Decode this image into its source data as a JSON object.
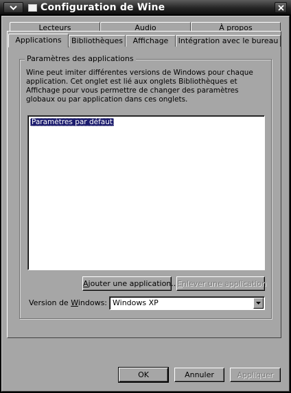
{
  "window": {
    "title": "Configuration de Wine",
    "icons": {
      "menu": "chevron-down-icon",
      "app": "window-icon",
      "close": "close-icon"
    }
  },
  "tabs": {
    "row_back": [
      "Lecteurs",
      "Audio",
      "À propos"
    ],
    "row_front": [
      "Applications",
      "Bibliothèques",
      "Affichage",
      "Intégration avec le bureau"
    ],
    "selected": "Applications"
  },
  "applications": {
    "group_title": "Paramètres des applications",
    "description": "Wine peut imiter différentes versions de Windows pour chaque application.  Cet onglet est lié aux onglets Bibliothèques et Affichage pour vous permettre de changer des paramètres globaux ou par application dans ces onglets.",
    "list": [
      "Paramètres par défaut"
    ],
    "selected_item": "Paramètres par défaut",
    "add_button": {
      "before": "",
      "key": "A",
      "after": "jouter une application..."
    },
    "remove_button": {
      "before": "",
      "key": "E",
      "after": "nlever une application"
    },
    "version_label": {
      "before": "Version de ",
      "key": "W",
      "after": "indows:"
    },
    "version_value": "Windows XP"
  },
  "footer": {
    "ok": "OK",
    "cancel": "Annuler",
    "apply": "Appliquer"
  },
  "colors": {
    "dialog_bg": "#a6a6a6",
    "titlebar": "#262626",
    "selection": "#1c1c6e",
    "disabled_text": "#7c7c7c"
  }
}
